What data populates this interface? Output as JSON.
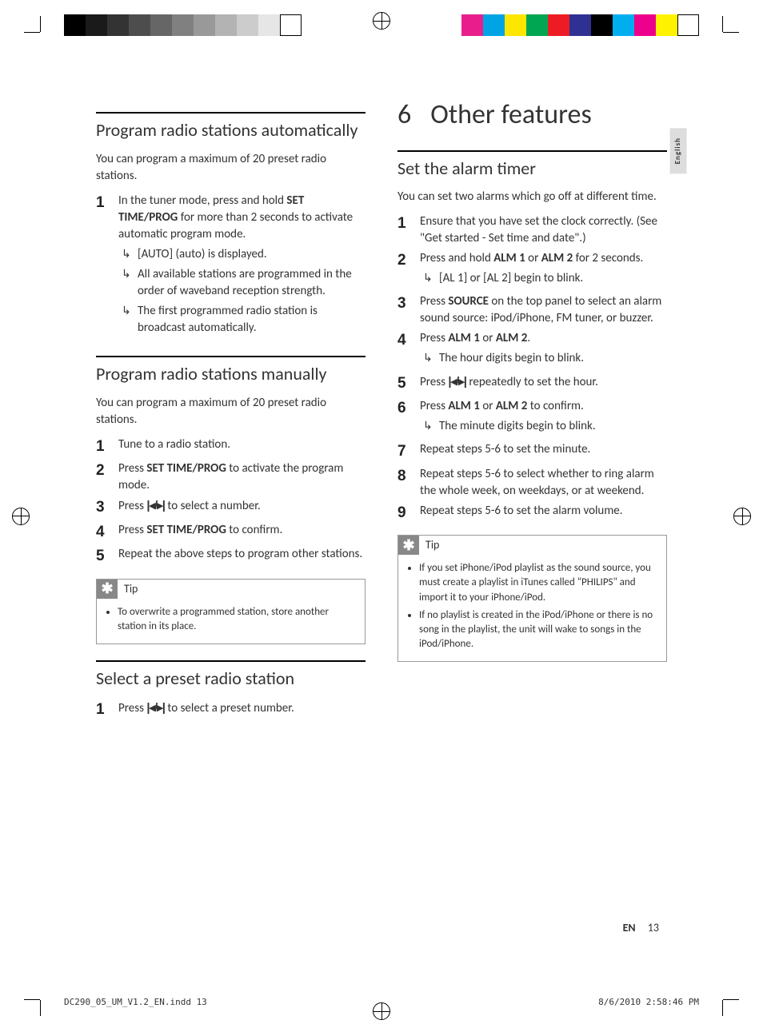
{
  "lang_tab": "English",
  "left": {
    "sec1": {
      "title": "Program radio stations automatically",
      "intro": "You can program a maximum of 20 preset radio stations.",
      "step1_a": "In the tuner mode, press and hold ",
      "step1_b": "SET TIME/PROG",
      "step1_c": " for more than 2 seconds to activate automatic program mode.",
      "r1": "[AUTO] (auto) is displayed.",
      "r2": "All available stations are programmed in the order of waveband reception strength.",
      "r3": "The first programmed radio station is broadcast automatically."
    },
    "sec2": {
      "title": "Program radio stations manually",
      "intro": "You can program a maximum of 20 preset radio stations.",
      "s1": "Tune to a radio station.",
      "s2a": "Press ",
      "s2b": "SET TIME/PROG",
      "s2c": " to activate the program mode.",
      "s3a": "Press ",
      "s3b": " to select a number.",
      "s4a": "Press ",
      "s4b": "SET TIME/PROG",
      "s4c": " to confirm.",
      "s5": "Repeat the above steps to program other stations.",
      "tip_label": "Tip",
      "tip1": "To overwrite a programmed station, store another station in its place."
    },
    "sec3": {
      "title": "Select a preset radio station",
      "s1a": "Press ",
      "s1b": " to select a preset number."
    }
  },
  "right": {
    "chapter_num": "6",
    "chapter_title": "Other features",
    "sec1": {
      "title": "Set the alarm timer",
      "intro": "You can set two alarms which go off at different time.",
      "s1": "Ensure that you have set the clock correctly. (See \"Get started - Set time and date\".)",
      "s2a": "Press and hold ",
      "s2b": "ALM 1",
      "s2c": " or ",
      "s2d": "ALM 2",
      "s2e": " for 2 seconds.",
      "s2r": "[AL 1] or [AL 2] begin to blink.",
      "s3a": "Press ",
      "s3b": "SOURCE",
      "s3c": " on the top panel to select an alarm sound source: iPod/iPhone, FM tuner, or buzzer.",
      "s4a": "Press ",
      "s4b": "ALM 1",
      "s4c": " or ",
      "s4d": "ALM 2",
      "s4e": ".",
      "s4r": "The hour digits begin to blink.",
      "s5a": "Press ",
      "s5b": " repeatedly to set the hour.",
      "s6a": "Press ",
      "s6b": "ALM 1",
      "s6c": " or ",
      "s6d": "ALM 2",
      "s6e": " to confirm.",
      "s6r": "The minute digits begin to blink.",
      "s7": "Repeat steps 5-6 to set the minute.",
      "s8": "Repeat steps 5-6 to select whether to ring alarm the whole week, on weekdays, or at weekend.",
      "s9": "Repeat steps 5-6 to set the alarm volume.",
      "tip_label": "Tip",
      "tip1": "If you set iPhone/iPod playlist as the sound source, you must create a playlist in iTunes called \"PHILIPS\" and import it to your iPhone/iPod.",
      "tip2": "If no playlist is created in the iPod/iPhone or there is no song in the playlist, the unit will wake to songs in the iPod/iPhone."
    }
  },
  "footer": {
    "lang": "EN",
    "page": "13"
  },
  "print": {
    "file": "DC290_05_UM_V1.2_EN.indd   13",
    "stamp": "8/6/2010   2:58:46 PM"
  },
  "skip_icon": "|◂/▸|"
}
